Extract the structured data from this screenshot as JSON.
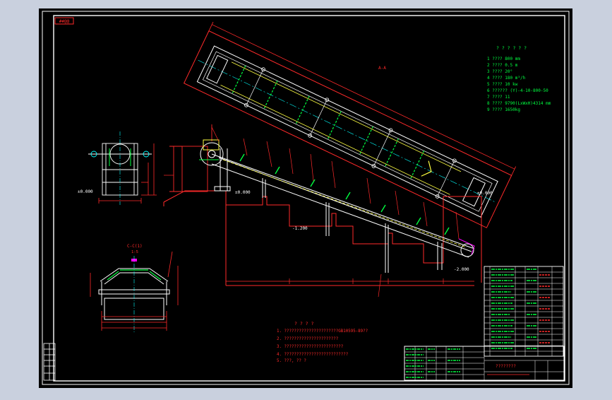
{
  "colors": {
    "viewport_bg": "#c9d0de",
    "paper": "#000000",
    "frame": "#ffffff",
    "line_red": "#ff2a2a",
    "line_white": "#ffffff",
    "line_yellow": "#ffff40",
    "line_green": "#00ff40",
    "line_cyan": "#00ffff",
    "line_magenta": "#ff00ff"
  },
  "drawing": {
    "top_left_stamp": "##@@",
    "plan_view_label": "A-A",
    "tech_params": {
      "title": "? ? ? ? ? ?",
      "rows": [
        "1 ????     800 mm",
        "2 ????     0.5  m",
        "3 ????     20°",
        "4 ????     180 m³/h",
        "5 ????     10 kw",
        "6 ??????   (Y)-4-10-800-50",
        "7 ????     11",
        "8 ????     9790(LxWxH)4314 mm",
        "9 ????     1650kg"
      ]
    },
    "elevation_labels": {
      "left_low": "±0.000",
      "left_side": "±0.000",
      "right_top": "±0.000",
      "pit": "-1.200",
      "right_low": "-2.000"
    },
    "section_label": "C-C(1)",
    "section_scale": "1:5",
    "notes": {
      "title": "? ? ? ?",
      "items": [
        "1. ??????????????????????GB10595-89??",
        "2. ??????????????????????",
        "3. ????????????????????????",
        "4. ??????????????????????????",
        "5. ???,  ??       ?"
      ]
    },
    "title_block_name": "????????"
  }
}
